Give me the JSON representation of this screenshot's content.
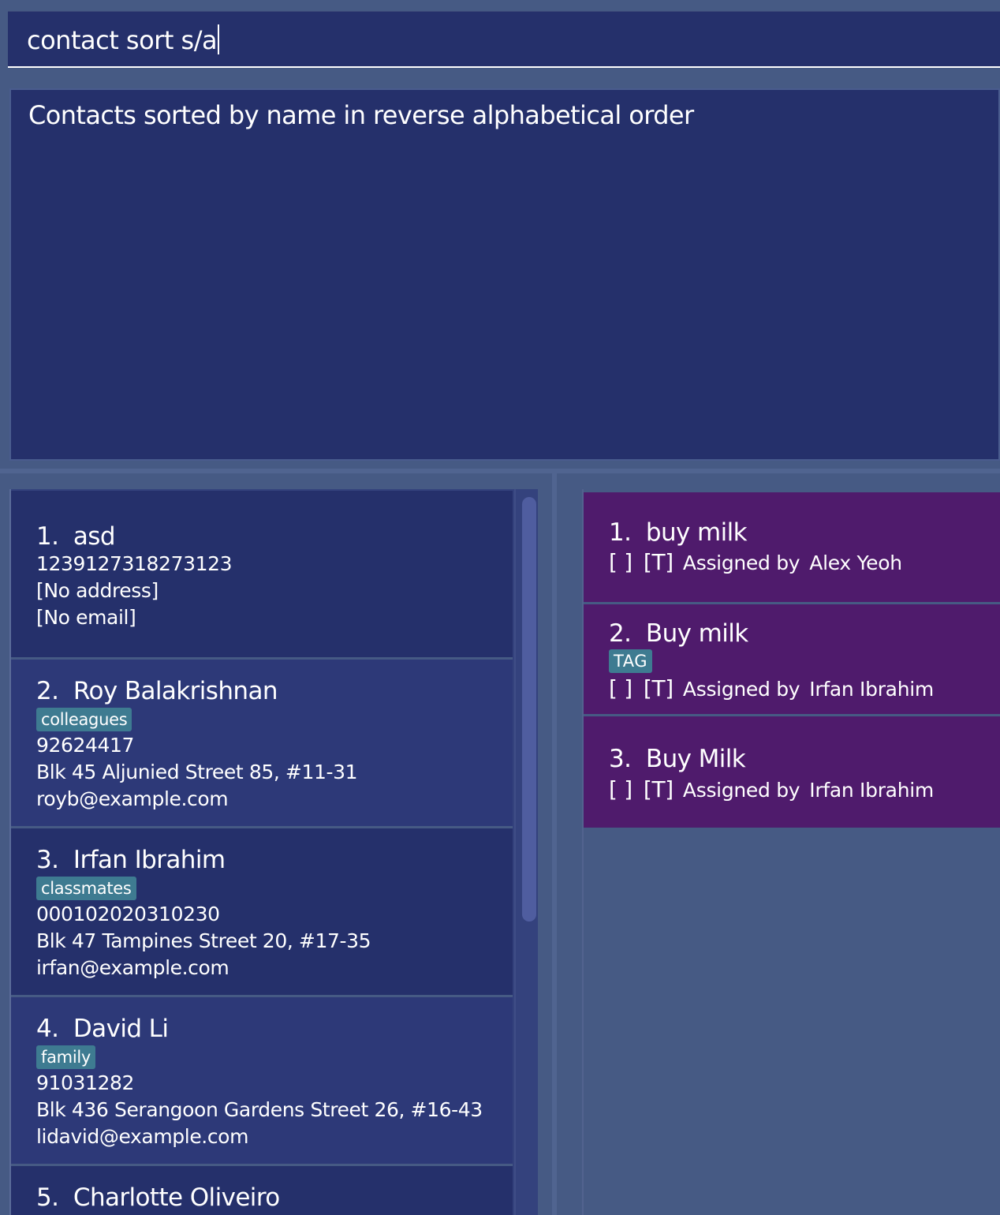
{
  "command": {
    "value": "contact sort s/a"
  },
  "result": {
    "message": "Contacts sorted by name in reverse alphabetical order"
  },
  "contacts": [
    {
      "index": "1.",
      "name": "asd",
      "tag": "",
      "phone": "1239127318273123",
      "address": "[No address]",
      "email": "[No email]"
    },
    {
      "index": "2.",
      "name": "Roy Balakrishnan",
      "tag": "colleagues",
      "phone": "92624417",
      "address": "Blk 45 Aljunied Street 85, #11-31",
      "email": "royb@example.com"
    },
    {
      "index": "3.",
      "name": "Irfan Ibrahim",
      "tag": "classmates",
      "phone": "000102020310230",
      "address": "Blk 47 Tampines Street 20, #17-35",
      "email": "irfan@example.com"
    },
    {
      "index": "4.",
      "name": "David Li",
      "tag": "family",
      "phone": "91031282",
      "address": "Blk 436 Serangoon Gardens Street 26, #16-43",
      "email": "lidavid@example.com"
    },
    {
      "index": "5.",
      "name": "Charlotte Oliveiro"
    }
  ],
  "tasks": [
    {
      "index": "1.",
      "title": "buy milk",
      "tag": "",
      "checkbox": "[ ]",
      "type": "[T]",
      "assigned_label": "Assigned by",
      "assignee": "Alex Yeoh"
    },
    {
      "index": "2.",
      "title": "Buy milk",
      "tag": "TAG",
      "checkbox": "[ ]",
      "type": "[T]",
      "assigned_label": "Assigned by",
      "assignee": "Irfan Ibrahim"
    },
    {
      "index": "3.",
      "title": "Buy Milk",
      "tag": "",
      "checkbox": "[ ]",
      "type": "[T]",
      "assigned_label": "Assigned by",
      "assignee": "Irfan Ibrahim"
    }
  ],
  "colors": {
    "background": "#465a84",
    "panel": "#25306b",
    "card_alt": "#2d3978",
    "task_card": "#4f1b6c",
    "tag": "#3e7b91",
    "scroll_thumb": "#4f5d9f"
  }
}
